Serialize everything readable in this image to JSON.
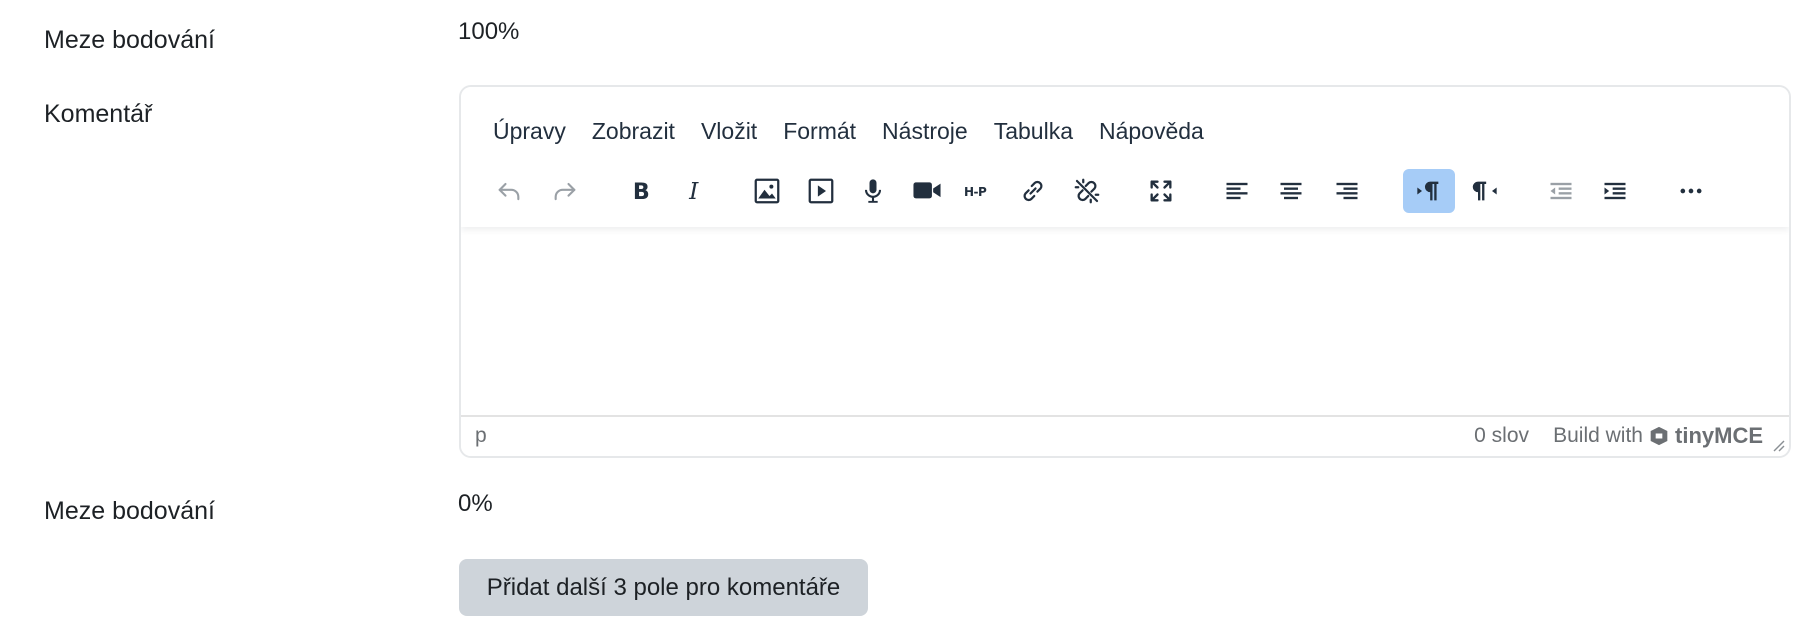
{
  "rows": {
    "grade_boundary_1": {
      "label": "Meze bodování",
      "value": "100%"
    },
    "comment": {
      "label": "Komentář"
    },
    "grade_boundary_2": {
      "label": "Meze bodování",
      "value": "0%"
    }
  },
  "editor": {
    "menubar": [
      "Úpravy",
      "Zobrazit",
      "Vložit",
      "Formát",
      "Nástroje",
      "Tabulka",
      "Nápověda"
    ],
    "toolbar": [
      {
        "icon": "undo-icon",
        "state": "disabled"
      },
      {
        "icon": "redo-icon",
        "state": "disabled"
      },
      {
        "icon": "bold-icon",
        "state": "normal"
      },
      {
        "icon": "italic-icon",
        "state": "normal"
      },
      {
        "icon": "image-icon",
        "state": "normal"
      },
      {
        "icon": "media-icon",
        "state": "normal"
      },
      {
        "icon": "microphone-icon",
        "state": "normal"
      },
      {
        "icon": "video-camera-icon",
        "state": "normal"
      },
      {
        "icon": "h5p-icon",
        "state": "normal"
      },
      {
        "icon": "link-icon",
        "state": "normal"
      },
      {
        "icon": "unlink-icon",
        "state": "normal"
      },
      {
        "icon": "fullscreen-icon",
        "state": "normal"
      },
      {
        "icon": "align-left-icon",
        "state": "normal"
      },
      {
        "icon": "align-center-icon",
        "state": "normal"
      },
      {
        "icon": "align-right-icon",
        "state": "normal"
      },
      {
        "icon": "ltr-icon",
        "state": "active"
      },
      {
        "icon": "rtl-icon",
        "state": "normal"
      },
      {
        "icon": "outdent-icon",
        "state": "disabled"
      },
      {
        "icon": "indent-icon",
        "state": "normal"
      },
      {
        "icon": "more-icon",
        "state": "normal"
      }
    ],
    "h5p_text": "H-P",
    "statusbar": {
      "path": "p",
      "word_count": "0 slov",
      "branding_prefix": "Build with",
      "branding_name": "tinyMCE"
    },
    "colors": {
      "active_button": "#a6ccf7",
      "disabled_icon": "#9aa0a6",
      "icon": "#222f3e"
    }
  },
  "actions": {
    "add_comment_fields": "Přidat další 3 pole pro komentáře"
  }
}
